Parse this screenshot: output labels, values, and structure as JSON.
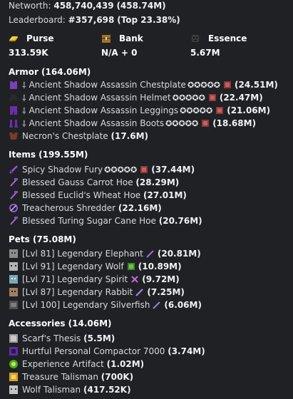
{
  "networth": {
    "label": "Networth:",
    "value": "458,740,439",
    "short": "(458.74M)"
  },
  "leaderboard": {
    "label": "Leaderboard:",
    "rank": "#357,698",
    "top": "(Top 23.38%)"
  },
  "stats": {
    "purse": {
      "label": "Purse",
      "value": "313.59K"
    },
    "bank": {
      "label": "Bank",
      "value": "N/A + 0"
    },
    "essence": {
      "label": "Essence",
      "value": "5.67M"
    }
  },
  "armor": {
    "header": "Armor (164.06M)",
    "items": [
      {
        "prefix": "⸸",
        "name": "Ancient Shadow Assassin Chestplate",
        "stars": "✪✪✪✪✪",
        "value": "(24.51M)"
      },
      {
        "prefix": "⸸",
        "name": "Ancient Shadow Assassin Helmet",
        "stars": "✪✪✪✪✪",
        "value": "(22.47M)"
      },
      {
        "prefix": "⸸",
        "name": "Ancient Shadow Assassin Leggings",
        "stars": "✪✪✪✪✪",
        "value": "(21.06M)"
      },
      {
        "prefix": "⸸",
        "name": "Ancient Shadow Assassin Boots",
        "stars": "✪✪✪✪✪",
        "value": "(18.68M)"
      },
      {
        "prefix": "",
        "name": "Necron's Chestplate",
        "stars": "",
        "value": "(17.6M)"
      }
    ]
  },
  "items": {
    "header": "Items (199.55M)",
    "items": [
      {
        "name": "Spicy Shadow Fury",
        "stars": "✪✪✪✪✪",
        "value": "(37.44M)"
      },
      {
        "name": "Blessed Gauss Carrot Hoe",
        "stars": "",
        "value": "(28.29M)"
      },
      {
        "name": "Blessed Euclid's Wheat Hoe",
        "stars": "",
        "value": "(27.01M)"
      },
      {
        "name": "Treacherous Shredder",
        "stars": "",
        "value": "(22.16M)"
      },
      {
        "name": "Blessed Turing Sugar Cane Hoe",
        "stars": "",
        "value": "(20.76M)"
      }
    ]
  },
  "pets": {
    "header": "Pets (75.08M)",
    "items": [
      {
        "name": "[Lvl 81] Legendary Elephant",
        "value": "(20.81M)"
      },
      {
        "name": "[Lvl 91] Legendary Wolf",
        "value": "(10.89M)"
      },
      {
        "name": "[Lvl 71] Legendary Spirit",
        "value": "(9.72M)"
      },
      {
        "name": "[Lvl 87] Legendary Rabbit",
        "value": "(7.25M)"
      },
      {
        "name": "[Lvl 100] Legendary Silverfish",
        "value": "(6.06M)"
      }
    ]
  },
  "accessories": {
    "header": "Accessories (14.06M)",
    "items": [
      {
        "name": "Scarf's Thesis",
        "value": "(5.5M)"
      },
      {
        "name": "Hurtful Personal Compactor 7000",
        "value": "(3.74M)"
      },
      {
        "name": "Experience Artifact",
        "value": "(1.02M)"
      },
      {
        "name": "Treasure Talisman",
        "value": "(700K)"
      },
      {
        "name": "Wolf Talisman",
        "value": "(417.52K)"
      }
    ]
  }
}
